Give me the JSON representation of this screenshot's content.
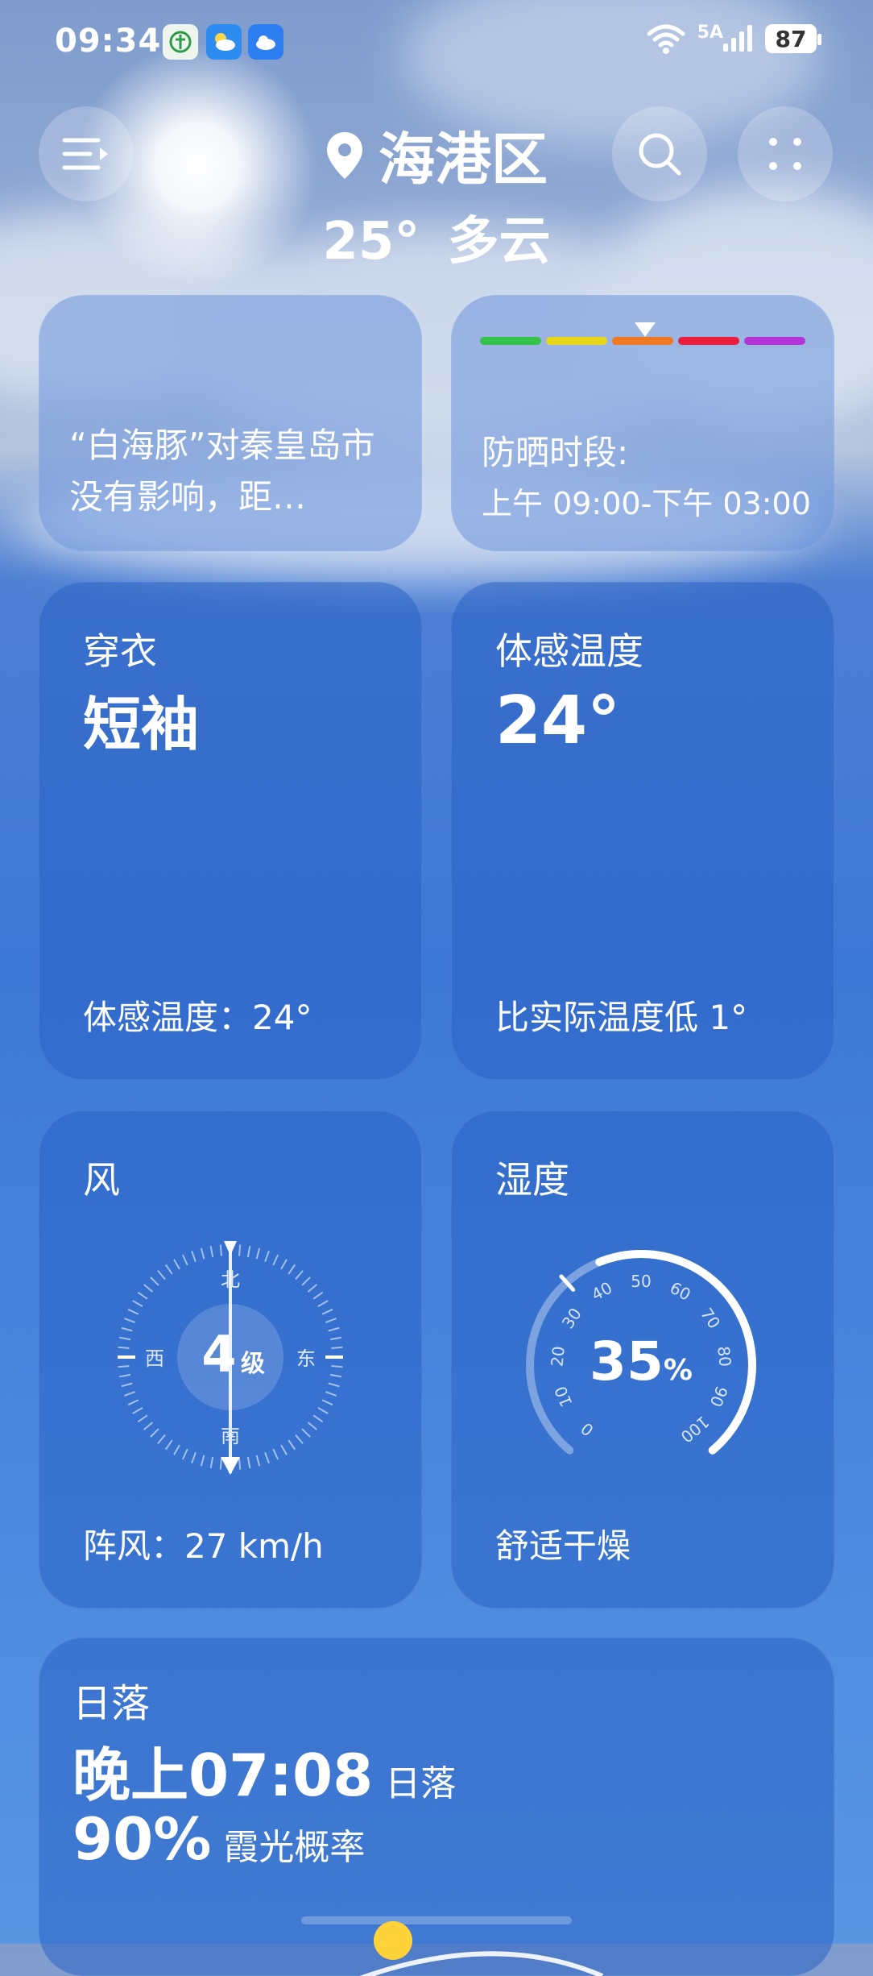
{
  "status": {
    "time": "09:34",
    "network": "5A",
    "battery": "87"
  },
  "header": {
    "location": "海港区",
    "temperature": "25°",
    "condition": "多云"
  },
  "cards": {
    "news": {
      "text": "“白海豚”对秦皇岛市没有影响，距…"
    },
    "uv": {
      "title": "防晒时段:",
      "period": "上午 09:00-下午 03:00",
      "colors": [
        "#34c24b",
        "#e8d619",
        "#f07a24",
        "#e91d3d",
        "#b534d6"
      ]
    },
    "clothing": {
      "title": "穿衣",
      "value": "短袖",
      "footer": "体感温度：24°"
    },
    "feels_like": {
      "title": "体感温度",
      "value": "24°",
      "footer": "比实际温度低 1°"
    },
    "wind": {
      "title": "风",
      "level": "4",
      "level_unit": "级",
      "dir_n": "北",
      "dir_s": "南",
      "dir_e": "东",
      "dir_w": "西",
      "footer": "阵风：27 km/h"
    },
    "humidity": {
      "title": "湿度",
      "value": "35",
      "unit": "%",
      "ticks": [
        "0",
        "10",
        "20",
        "30",
        "40",
        "50",
        "60",
        "70",
        "80",
        "90",
        "100"
      ],
      "footer": "舒适干燥"
    },
    "sunset": {
      "title": "日落",
      "time": "晚上07:08",
      "time_suffix": "日落",
      "glow_percent": "90%",
      "glow_label": "霞光概率"
    }
  }
}
